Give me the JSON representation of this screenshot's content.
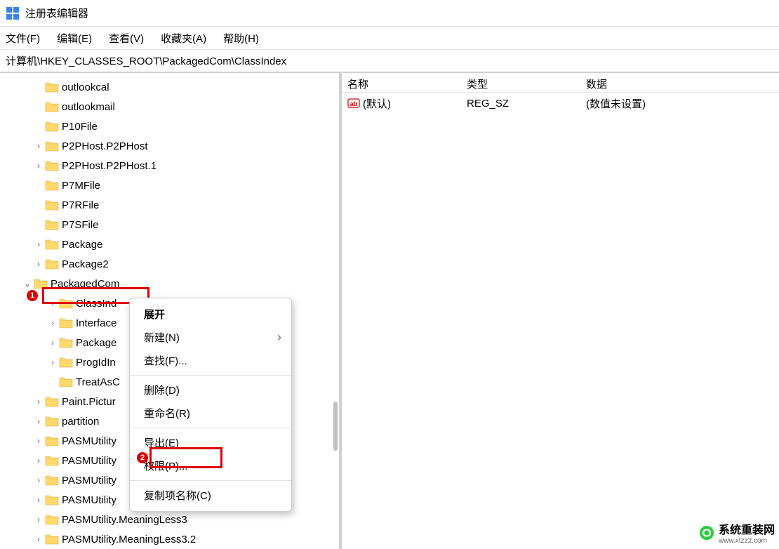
{
  "app": {
    "title": "注册表编辑器"
  },
  "menu": {
    "file": "文件(F)",
    "edit": "编辑(E)",
    "view": "查看(V)",
    "fav": "收藏夹(A)",
    "help": "帮助(H)"
  },
  "address": "计算机\\HKEY_CLASSES_ROOT\\PackagedCom\\ClassIndex",
  "tree": [
    {
      "indent": 48,
      "exp": "",
      "label": "outlookcal"
    },
    {
      "indent": 48,
      "exp": "",
      "label": "outlookmail"
    },
    {
      "indent": 48,
      "exp": "",
      "label": "P10File"
    },
    {
      "indent": 48,
      "exp": ">",
      "label": "P2PHost.P2PHost"
    },
    {
      "indent": 48,
      "exp": ">",
      "label": "P2PHost.P2PHost.1"
    },
    {
      "indent": 48,
      "exp": "",
      "label": "P7MFile"
    },
    {
      "indent": 48,
      "exp": "",
      "label": "P7RFile"
    },
    {
      "indent": 48,
      "exp": "",
      "label": "P7SFile"
    },
    {
      "indent": 48,
      "exp": ">",
      "label": "Package"
    },
    {
      "indent": 48,
      "exp": ">",
      "label": "Package2"
    },
    {
      "indent": 32,
      "exp": "v",
      "label": "PackagedCom"
    },
    {
      "indent": 68,
      "exp": ">",
      "label": "ClassInd",
      "selected": true
    },
    {
      "indent": 68,
      "exp": ">",
      "label": "Interface"
    },
    {
      "indent": 68,
      "exp": ">",
      "label": "Package"
    },
    {
      "indent": 68,
      "exp": ">",
      "label": "ProgIdIn"
    },
    {
      "indent": 68,
      "exp": "",
      "label": "TreatAsC"
    },
    {
      "indent": 48,
      "exp": ">",
      "label": "Paint.Pictur"
    },
    {
      "indent": 48,
      "exp": ">",
      "label": "partition"
    },
    {
      "indent": 48,
      "exp": ">",
      "label": "PASMUtility"
    },
    {
      "indent": 48,
      "exp": ">",
      "label": "PASMUtility"
    },
    {
      "indent": 48,
      "exp": ">",
      "label": "PASMUtility"
    },
    {
      "indent": 48,
      "exp": ">",
      "label": "PASMUtility"
    },
    {
      "indent": 48,
      "exp": ">",
      "label": "PASMUtility.MeaningLess3"
    },
    {
      "indent": 48,
      "exp": ">",
      "label": "PASMUtility.MeaningLess3.2"
    }
  ],
  "badges": {
    "b1": "1",
    "b2": "2"
  },
  "values": {
    "headers": {
      "name": "名称",
      "type": "类型",
      "data": "数据"
    },
    "rows": [
      {
        "name": "(默认)",
        "type": "REG_SZ",
        "data": "(数值未设置)"
      }
    ]
  },
  "context": {
    "expand": "展开",
    "new": "新建(N)",
    "find": "查找(F)...",
    "delete": "删除(D)",
    "rename": "重命名(R)",
    "export": "导出(E)",
    "perm": "权限(P)...",
    "copykey": "复制项名称(C)"
  },
  "watermark": {
    "text": "系统重装网",
    "url": "www.xtzz2.com"
  }
}
